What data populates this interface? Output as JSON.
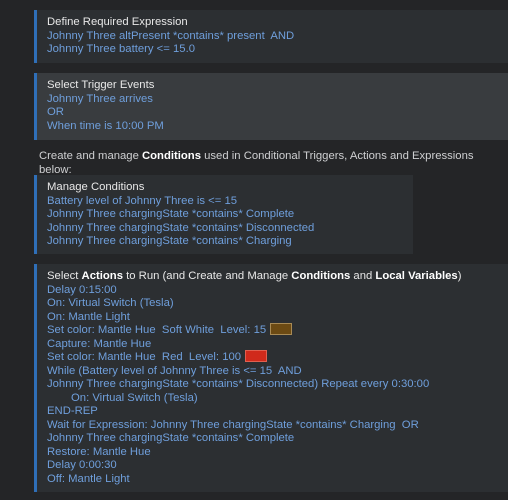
{
  "expression": {
    "title": "Define Required Expression",
    "lines": [
      "Johnny Three altPresent *contains* present  AND",
      "Johnny Three battery <= 15.0"
    ]
  },
  "triggers": {
    "title": "Select Trigger Events",
    "lines": [
      "Johnny Three arrives",
      "OR",
      "When time is 10:00 PM"
    ]
  },
  "conditions_info": {
    "prefix": "Create and manage ",
    "bold": "Conditions",
    "suffix": " used in Conditional Triggers, Actions and Expressions below:"
  },
  "manage_conditions": {
    "title": "Manage Conditions",
    "lines": [
      "Battery level of Johnny Three is <= 15",
      "Johnny Three chargingState *contains* Complete",
      "Johnny Three chargingState *contains* Disconnected",
      "Johnny Three chargingState *contains* Charging"
    ]
  },
  "actions": {
    "title_parts": {
      "p1": "Select ",
      "b1": "Actions",
      "p2": " to Run (and Create and Manage ",
      "b2": "Conditions",
      "p3": " and ",
      "b3": "Local Variables",
      "p4": ")"
    },
    "lines": [
      "Delay 0:15:00",
      "On: Virtual Switch (Tesla)",
      "On: Mantle Light",
      "Set color: Mantle Hue  Soft White  Level: 15",
      "Capture: Mantle Hue",
      "Set color: Mantle Hue  Red  Level: 100",
      "While (Battery level of Johnny Three is <= 15  AND",
      "Johnny Three chargingState *contains* Disconnected) Repeat every 0:30:00",
      "On: Virtual Switch (Tesla)",
      "END-REP",
      "Wait for Expression: Johnny Three chargingState *contains* Charging  OR",
      "Johnny Three chargingState *contains* Complete",
      "Restore: Mantle Hue",
      "Delay 0:00:30",
      "Off: Mantle Light"
    ],
    "swatch_colors": {
      "soft_white": "#6c4a13",
      "red": "#d02a1b"
    }
  },
  "colors": {
    "accent_border": "#2f6fb8",
    "link_text": "#6f9fdc",
    "page_bg": "#242527"
  }
}
